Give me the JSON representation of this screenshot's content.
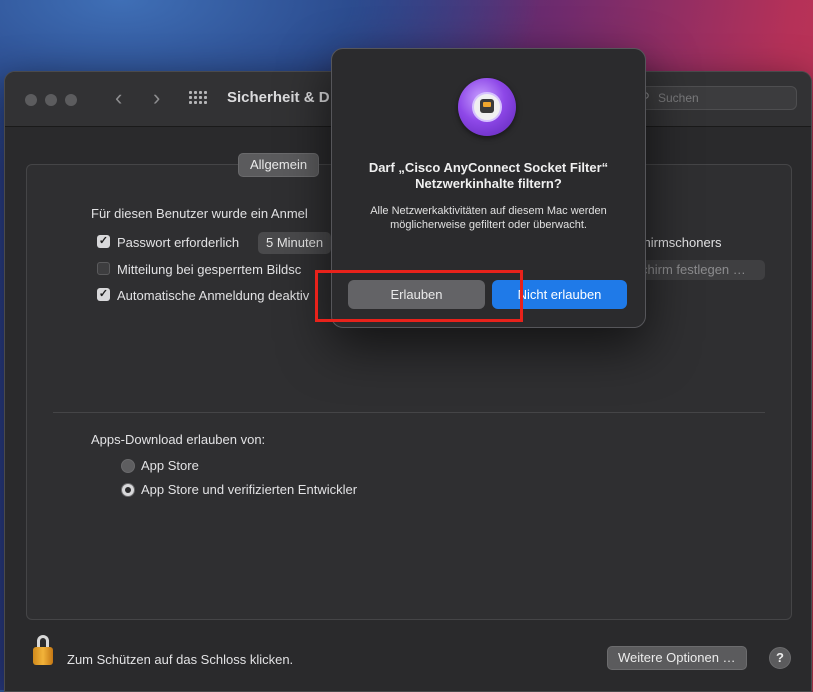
{
  "window": {
    "title": "Sicherheit & D",
    "nav_back": "‹",
    "nav_forward": "›",
    "search": {
      "placeholder": "Suchen",
      "icon": "magnifier-icon"
    }
  },
  "tabs": {
    "active": "Allgemein"
  },
  "general": {
    "login_text": "Für diesen Benutzer wurde ein Anmel",
    "require_password": {
      "label": "Passwort erforderlich",
      "checked": true,
      "popup_value": "5 Minuten"
    },
    "screensaver_text": "chirmschoners",
    "lock_message": {
      "label": "Mitteilung bei gesperrtem Bildsc",
      "checked": false
    },
    "set_button_label": "chirm festlegen …",
    "auto_login": {
      "label": "Automatische Anmeldung deaktiv",
      "checked": true
    },
    "check_mark": "✓"
  },
  "apps_download": {
    "heading": "Apps-Download erlauben von:",
    "options": [
      {
        "label": "App Store",
        "selected": false
      },
      {
        "label": "App Store und verifizierten Entwickler",
        "selected": true
      }
    ]
  },
  "footer": {
    "lock_text": "Zum Schützen auf das Schloss klicken.",
    "more_options": "Weitere Optionen …",
    "help": "?"
  },
  "dialog": {
    "icon": "cisco-anyconnect-icon",
    "title_line1": "Darf „Cisco AnyConnect Socket Filter“",
    "title_line2": "Netzwerkinhalte filtern?",
    "message": "Alle Netzwerkaktivitäten auf diesem Mac werden möglicherweise gefiltert oder überwacht.",
    "allow_label": "Erlauben",
    "deny_label": "Nicht erlauben"
  },
  "colors": {
    "accent": "#1f7ae8",
    "highlight": "#e8221b"
  }
}
